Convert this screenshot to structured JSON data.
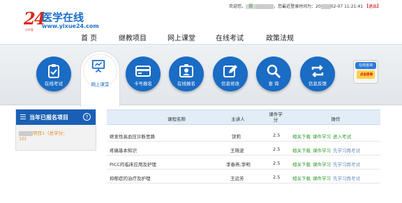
{
  "topbar": {
    "welcome": "欢迎您，",
    "user": "郑",
    "last_login_label": "，您最近登录时间为：",
    "login_time_prefix": "20",
    "login_time_suffix": "02-07 11:21:41",
    "logout": "【退出】"
  },
  "logo": {
    "number": "24",
    "name": "医学在线",
    "url": "www.yixue24.com",
    "tag": "小叶医"
  },
  "nav": {
    "items": [
      "首 页",
      "继教项目",
      "网上课堂",
      "在线考试",
      "政策法规"
    ]
  },
  "icons": {
    "exam": "在线考试",
    "classroom": "网上课堂",
    "card": "卡号报名",
    "signup": "在线报名",
    "profile": "信息修改",
    "query": "查 询",
    "feedback": "信息反馈"
  },
  "service": {
    "top": "在线咨询",
    "bottom": "点击咨询"
  },
  "left_panel": {
    "title": "当年已报名项目",
    "help": "?",
    "item_label": "项目1",
    "item_hours": "（总学分：",
    "item_hours_value": "10)"
  },
  "table": {
    "headers": {
      "name": "课程名称",
      "lecturer": "主讲人",
      "hours_line1": "课件学",
      "hours_line2": "分",
      "ops": "操作"
    },
    "rows": [
      {
        "name": "继发性高血压诊断思路",
        "lecturer": "饶莉",
        "hours": "2.5",
        "op1": "相关下载",
        "op2": "课件学习",
        "op3": "进入考试",
        "op3_state": "active"
      },
      {
        "name": "疼痛基本知识",
        "lecturer": "王晓波",
        "hours": "2.5",
        "op1": "相关下载",
        "op2": "课件学习",
        "op3": "先学习再考试",
        "op3_state": "pending"
      },
      {
        "name": "PICC的临床应用及护理",
        "lecturer": "李春燕;李明",
        "hours": "2.5",
        "op1": "相关下载",
        "op2": "课件学习",
        "op3": "先学习再考试",
        "op3_state": "pending"
      },
      {
        "name": "抑郁症的治疗及护理",
        "lecturer": "王远芳",
        "hours": "2.5",
        "op1": "相关下载",
        "op2": "课件学习",
        "op3": "先学习再考试",
        "op3_state": "pending"
      }
    ]
  },
  "colors": {
    "brand_blue": "#1a6cc4",
    "logo_red": "#d62a1e",
    "active_green": "#2e9a2e",
    "pending_blue": "#6b8fc0"
  }
}
